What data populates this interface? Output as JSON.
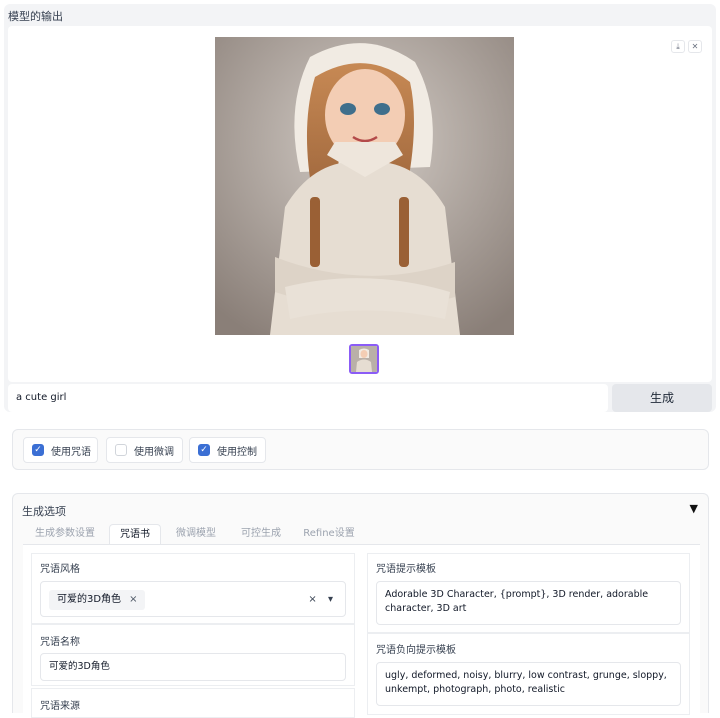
{
  "output": {
    "label": "模型的输出",
    "download_icon": "download-icon",
    "close_icon": "close-icon"
  },
  "prompt": {
    "value": "a cute girl",
    "generate_label": "生成"
  },
  "checkboxes": [
    {
      "label": "使用咒语",
      "checked": true
    },
    {
      "label": "使用微调",
      "checked": false
    },
    {
      "label": "使用控制",
      "checked": true
    }
  ],
  "options": {
    "title": "生成选项",
    "caret": "▼",
    "tabs": [
      {
        "label": "生成参数设置"
      },
      {
        "label": "咒语书"
      },
      {
        "label": "微调模型"
      },
      {
        "label": "可控生成"
      },
      {
        "label": "Refine设置"
      }
    ],
    "spell_style_label": "咒语风格",
    "spell_style_value": "可爱的3D角色",
    "chip_remove": "×",
    "clear": "×",
    "dropdown_arrow": "▾",
    "spell_name_label": "咒语名称",
    "spell_name_value": "可爱的3D角色",
    "spell_source_label": "咒语来源",
    "prompt_template_label": "咒语提示模板",
    "prompt_template_value": "Adorable 3D Character, {prompt}, 3D render, adorable character, 3D art",
    "negative_template_label": "咒语负向提示模板",
    "negative_template_value": "ugly, deformed, noisy, blurry, low contrast, grunge, sloppy, unkempt, photograph, photo, realistic"
  }
}
